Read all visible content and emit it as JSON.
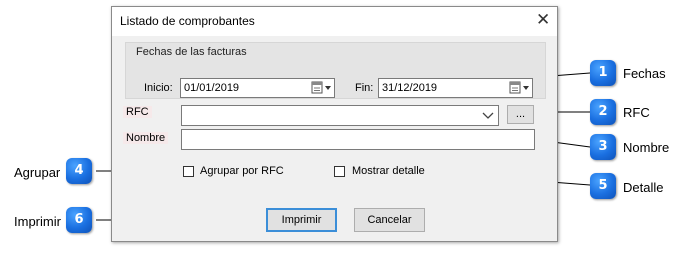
{
  "dialog": {
    "title": "Listado de comprobantes",
    "close_icon": "close-icon",
    "group_title": "Fechas de las facturas",
    "start_label": "Inicio:",
    "start_value": "01/01/2019",
    "end_label": "Fin:",
    "end_value": "31/12/2019",
    "rfc_label": "RFC",
    "rfc_value": "",
    "browse_label": "...",
    "name_label": "Nombre",
    "name_value": "",
    "group_by_rfc_label": "Agrupar por RFC",
    "show_detail_label": "Mostrar detalle",
    "print_label": "Imprimir",
    "cancel_label": "Cancelar"
  },
  "callouts": [
    {
      "number": "1",
      "label": "Fechas"
    },
    {
      "number": "2",
      "label": "RFC"
    },
    {
      "number": "3",
      "label": "Nombre"
    },
    {
      "number": "4",
      "label": "Agrupar"
    },
    {
      "number": "5",
      "label": "Detalle"
    },
    {
      "number": "6",
      "label": "Imprimir"
    }
  ],
  "colors": {
    "callout": "#1a6fe0",
    "default_button_border": "#3b8ed8",
    "label_highlight": "#f6e9ea"
  }
}
